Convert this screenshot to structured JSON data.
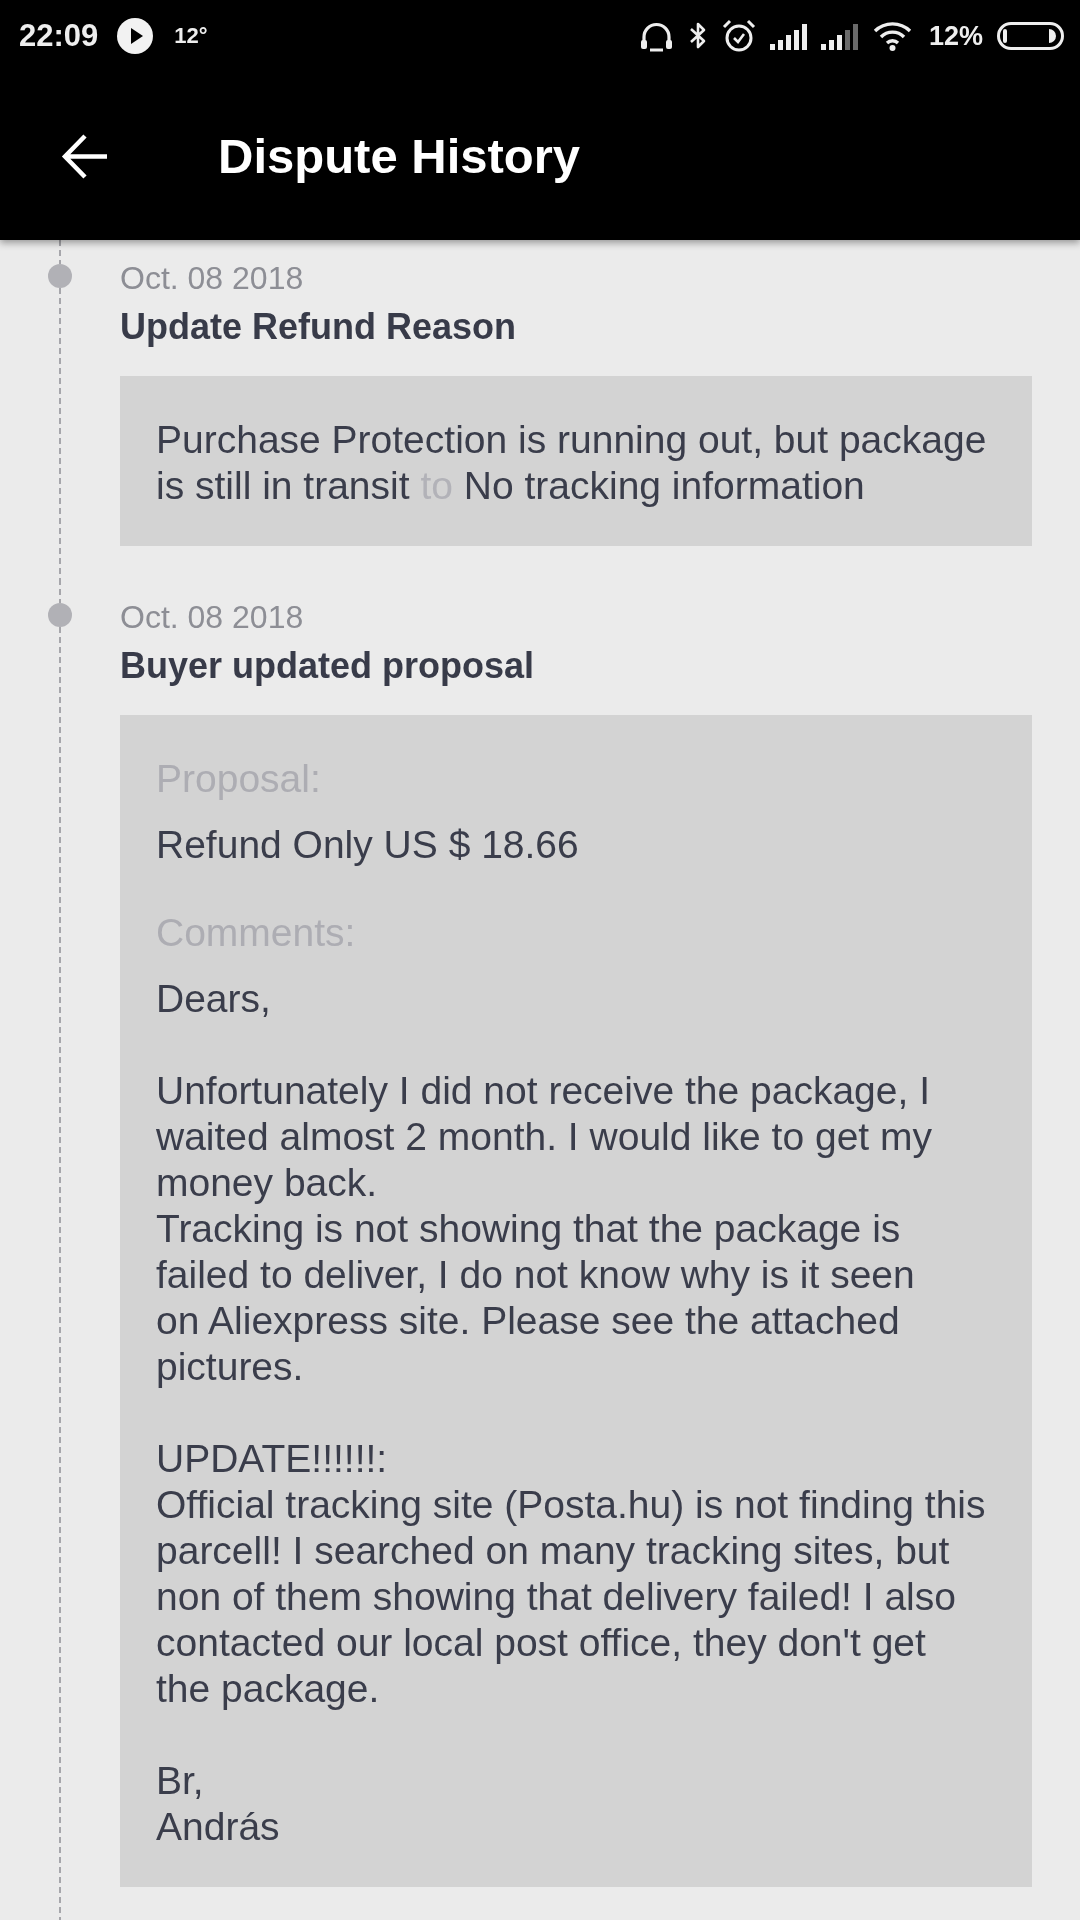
{
  "status_bar": {
    "time": "22:09",
    "temperature": "12°",
    "battery": "12%"
  },
  "app_bar": {
    "title": "Dispute History"
  },
  "events": [
    {
      "kind": "reason_change",
      "date": "Oct. 08 2018",
      "title": "Update Refund Reason",
      "from_reason": "Purchase Protection is running out, but package is still in transit",
      "connector": "to",
      "to_reason": "No tracking information"
    },
    {
      "kind": "proposal",
      "date": "Oct. 08 2018",
      "title": "Buyer updated proposal",
      "proposal_label": "Proposal:",
      "proposal": "Refund Only US $ 18.66",
      "comments_label": "Comments:",
      "comments": [
        "Dears,",
        "Unfortunately I did not receive the package, I\nwaited almost 2 month. I would like to get my\nmoney back.\nTracking is not showing that the package is\nfailed to deliver, I do not know why is it seen\non Aliexpress site. Please see the attached\npictures.",
        "UPDATE!!!!!!:\nOfficial tracking site (Posta.hu) is not finding this\nparcell! I searched on many tracking sites, but\nnon of them showing that delivery failed! I also\ncontacted our local post office, they don't get\nthe package.",
        "Br,\nAndrás"
      ]
    }
  ]
}
